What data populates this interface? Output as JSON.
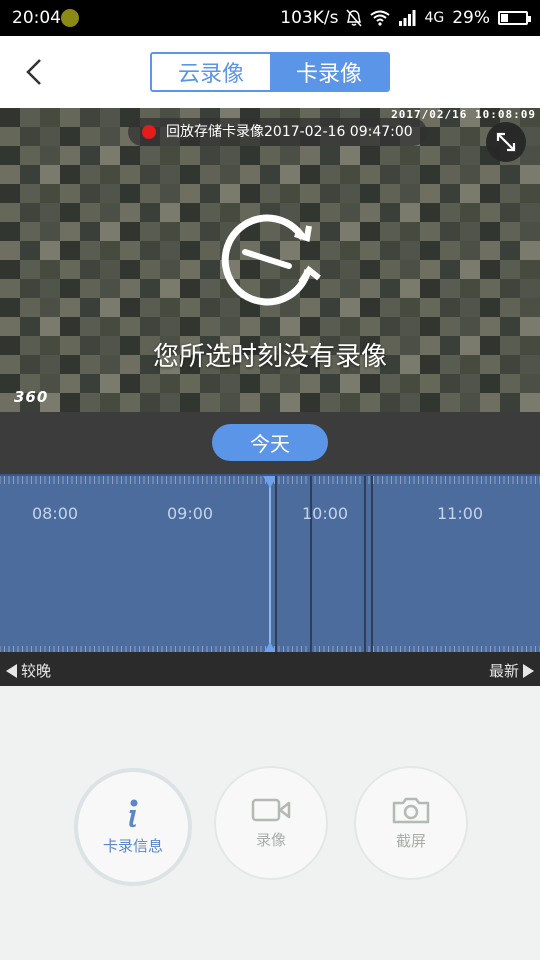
{
  "status_bar": {
    "time": "20:04",
    "network_speed": "103K/s",
    "network_type": "4G",
    "battery": "29%",
    "battery_fraction": 0.29,
    "icons": [
      "mute-icon",
      "wifi-icon",
      "signal-icon",
      "battery-icon"
    ]
  },
  "header": {
    "back_icon": "chevron-left-icon",
    "tabs": [
      {
        "label": "云录像",
        "selected": false
      },
      {
        "label": "卡录像",
        "selected": true
      }
    ]
  },
  "video": {
    "osd_timestamp": "2017/02/16  10:08:09",
    "playback_label": "回放存储卡录像2017-02-16 09:47:00",
    "no_recording_message": "您所选时刻没有录像",
    "watermark": "360",
    "expand_icon": "expand-arrows-icon",
    "replay_icon": "replay-clock-icon"
  },
  "today_button": "今天",
  "timeline": {
    "hour_labels": [
      "08:00",
      "09:00",
      "10:00",
      "11:00"
    ]
  },
  "timeline_nav": {
    "earlier": "较晚",
    "latest": "最新"
  },
  "actions": [
    {
      "label": "卡录信息",
      "icon": "info-icon",
      "active": true
    },
    {
      "label": "录像",
      "icon": "video-camera-icon",
      "active": false
    },
    {
      "label": "截屏",
      "icon": "camera-icon",
      "active": false
    }
  ],
  "colors": {
    "accent": "#5b95e8",
    "timeline_bg": "#4c6c9e",
    "record_dot": "#e31c1c"
  }
}
